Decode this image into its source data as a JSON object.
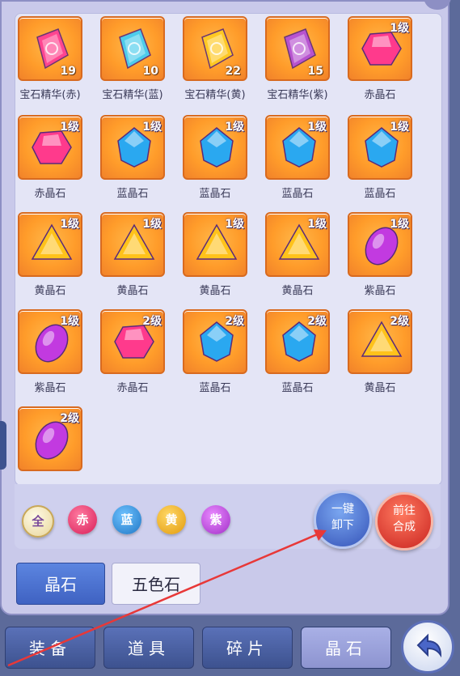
{
  "items": [
    {
      "name": "宝石精华(赤)",
      "qty": "19",
      "level": "",
      "kind": "essence",
      "color": "#ff3a9a"
    },
    {
      "name": "宝石精华(蓝)",
      "qty": "10",
      "level": "",
      "kind": "essence",
      "color": "#3ad0ff"
    },
    {
      "name": "宝石精华(黄)",
      "qty": "22",
      "level": "",
      "kind": "essence",
      "color": "#ffcc22"
    },
    {
      "name": "宝石精华(紫)",
      "qty": "15",
      "level": "",
      "kind": "essence",
      "color": "#b04ae0"
    },
    {
      "name": "赤晶石",
      "qty": "",
      "level": "1级",
      "kind": "round",
      "color": "#ff3a8c"
    },
    {
      "name": "赤晶石",
      "qty": "",
      "level": "1级",
      "kind": "round",
      "color": "#ff3a8c"
    },
    {
      "name": "蓝晶石",
      "qty": "",
      "level": "1级",
      "kind": "crystal",
      "color": "#2aa8f0"
    },
    {
      "name": "蓝晶石",
      "qty": "",
      "level": "1级",
      "kind": "crystal",
      "color": "#2aa8f0"
    },
    {
      "name": "蓝晶石",
      "qty": "",
      "level": "1级",
      "kind": "crystal",
      "color": "#2aa8f0"
    },
    {
      "name": "蓝晶石",
      "qty": "",
      "level": "1级",
      "kind": "crystal",
      "color": "#2aa8f0"
    },
    {
      "name": "黄晶石",
      "qty": "",
      "level": "1级",
      "kind": "triangle",
      "color": "#ffc21a"
    },
    {
      "name": "黄晶石",
      "qty": "",
      "level": "1级",
      "kind": "triangle",
      "color": "#ffc21a"
    },
    {
      "name": "黄晶石",
      "qty": "",
      "level": "1级",
      "kind": "triangle",
      "color": "#ffc21a"
    },
    {
      "name": "黄晶石",
      "qty": "",
      "level": "1级",
      "kind": "triangle",
      "color": "#ffc21a"
    },
    {
      "name": "紫晶石",
      "qty": "",
      "level": "1级",
      "kind": "oval",
      "color": "#c23ae0"
    },
    {
      "name": "紫晶石",
      "qty": "",
      "level": "1级",
      "kind": "oval",
      "color": "#c23ae0"
    },
    {
      "name": "赤晶石",
      "qty": "",
      "level": "2级",
      "kind": "round",
      "color": "#ff3a8c"
    },
    {
      "name": "蓝晶石",
      "qty": "",
      "level": "2级",
      "kind": "crystal",
      "color": "#2aa8f0"
    },
    {
      "name": "蓝晶石",
      "qty": "",
      "level": "2级",
      "kind": "crystal",
      "color": "#2aa8f0"
    },
    {
      "name": "黄晶石",
      "qty": "",
      "level": "2级",
      "kind": "triangle",
      "color": "#ffc21a"
    },
    {
      "name": "",
      "qty": "",
      "level": "2级",
      "kind": "oval",
      "color": "#c23ae0"
    }
  ],
  "filters": [
    {
      "label": "全",
      "bg": "#f3e8c0",
      "fg": "#7a4a9a"
    },
    {
      "label": "赤",
      "bg": "#e8326a",
      "fg": "#ffffff"
    },
    {
      "label": "蓝",
      "bg": "#2a8fd8",
      "fg": "#ffffff"
    },
    {
      "label": "黄",
      "bg": "#f0b21c",
      "fg": "#ffffff"
    },
    {
      "label": "紫",
      "bg": "#b340d8",
      "fg": "#ffffff"
    }
  ],
  "actions": {
    "unequip_line1": "一键",
    "unequip_line2": "卸下",
    "synth_line1": "前往",
    "synth_line2": "合成"
  },
  "tabs": {
    "crystal": "晶石",
    "five_color": "五色石"
  },
  "bottom_tabs": [
    "装备",
    "道具",
    "碎片",
    "晶石"
  ],
  "colors": {
    "orange_tile": "#ff9c2a",
    "panel": "#c9c9ea",
    "active_tab": "#4a6cc8",
    "arrow": "#e83838"
  }
}
